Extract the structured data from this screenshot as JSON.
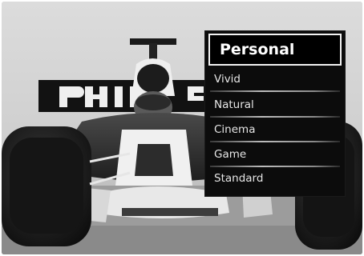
{
  "menu": {
    "selected": "Personal",
    "items": [
      {
        "label": "Vivid"
      },
      {
        "label": "Natural"
      },
      {
        "label": "Cinema"
      },
      {
        "label": "Game"
      },
      {
        "label": "Standard"
      }
    ]
  }
}
